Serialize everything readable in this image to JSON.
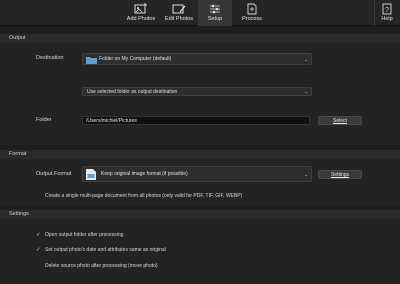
{
  "toolbar": {
    "add_photos": "Add Photos",
    "edit_photos": "Edit Photos",
    "setup": "Setup",
    "process": "Process",
    "help": "Help"
  },
  "output": {
    "section_title": "Output",
    "destination_label": "Destination",
    "destination_value": "Folder on My Computer (default)",
    "folder_mode_value": "Use selected folder as output destination",
    "folder_label": "Folder",
    "folder_value": "/Users/michiel/Pictures",
    "select_button": "Select"
  },
  "format": {
    "section_title": "Format",
    "output_format_label": "Output Format",
    "output_format_value": "Keep original image format (if possible)",
    "settings_button": "Settings",
    "multipage_checkbox": "Create a single multi-page document from all photos (only valid for PDF, TIF, GIF, WEBP)",
    "multipage_checked": false
  },
  "settings": {
    "section_title": "Settings",
    "open_folder": "Open output folder after processing",
    "open_folder_checked": true,
    "set_date": "Set output photo's date and attributes same as original",
    "set_date_checked": true,
    "delete_source": "Delete source photo after processing (move photo)",
    "delete_source_checked": false
  },
  "colors": {
    "background": "#1e1e1e",
    "accent_folder": "#5a9fd6"
  }
}
